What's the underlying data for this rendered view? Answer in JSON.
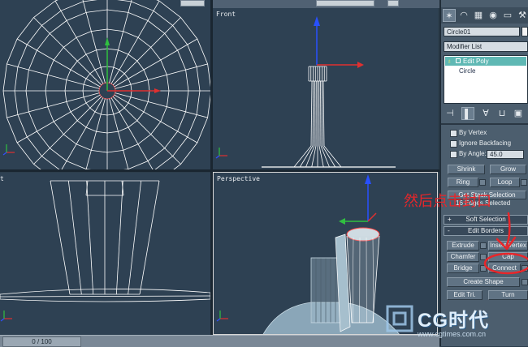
{
  "viewports": {
    "front_label": "Front",
    "left_label": "t",
    "perspective_label": "Perspective"
  },
  "status": {
    "frame_counter": "0 / 100"
  },
  "command_panel": {
    "object_name": "Circle01",
    "modifier_list": "Modifier List",
    "stack": [
      "Edit Poly",
      "Circle"
    ],
    "selection": {
      "by_vertex": "By Vertex",
      "ignore_backfacing": "Ignore Backfacing",
      "by_angle": "By Angle:",
      "angle_value": "45.0",
      "shrink": "Shrink",
      "grow": "Grow",
      "ring": "Ring",
      "loop": "Loop",
      "stack_selection": "Get Stack Selection",
      "edges_selected": "16 Edges Selected"
    },
    "soft_selection": "Soft Selection",
    "edit_borders": "Edit Borders",
    "buttons": {
      "extrude": "Extrude",
      "insert_vertex": "Insert Vertex",
      "chamfer": "Chamfer",
      "cap": "Cap",
      "bridge": "Bridge",
      "connect": "Connect",
      "create_shape": "Create Shape",
      "edit_tri": "Edit Tri.",
      "turn": "Turn"
    },
    "colors": {
      "panel_bg": "#4c5e6e",
      "stack_highlight": "#5fb8b4",
      "accent": "#e8262a"
    }
  },
  "annotation": {
    "text": "然后点击封口"
  },
  "watermark": {
    "brand": "CG时代",
    "url": "www.cgtimes.com.cn"
  }
}
